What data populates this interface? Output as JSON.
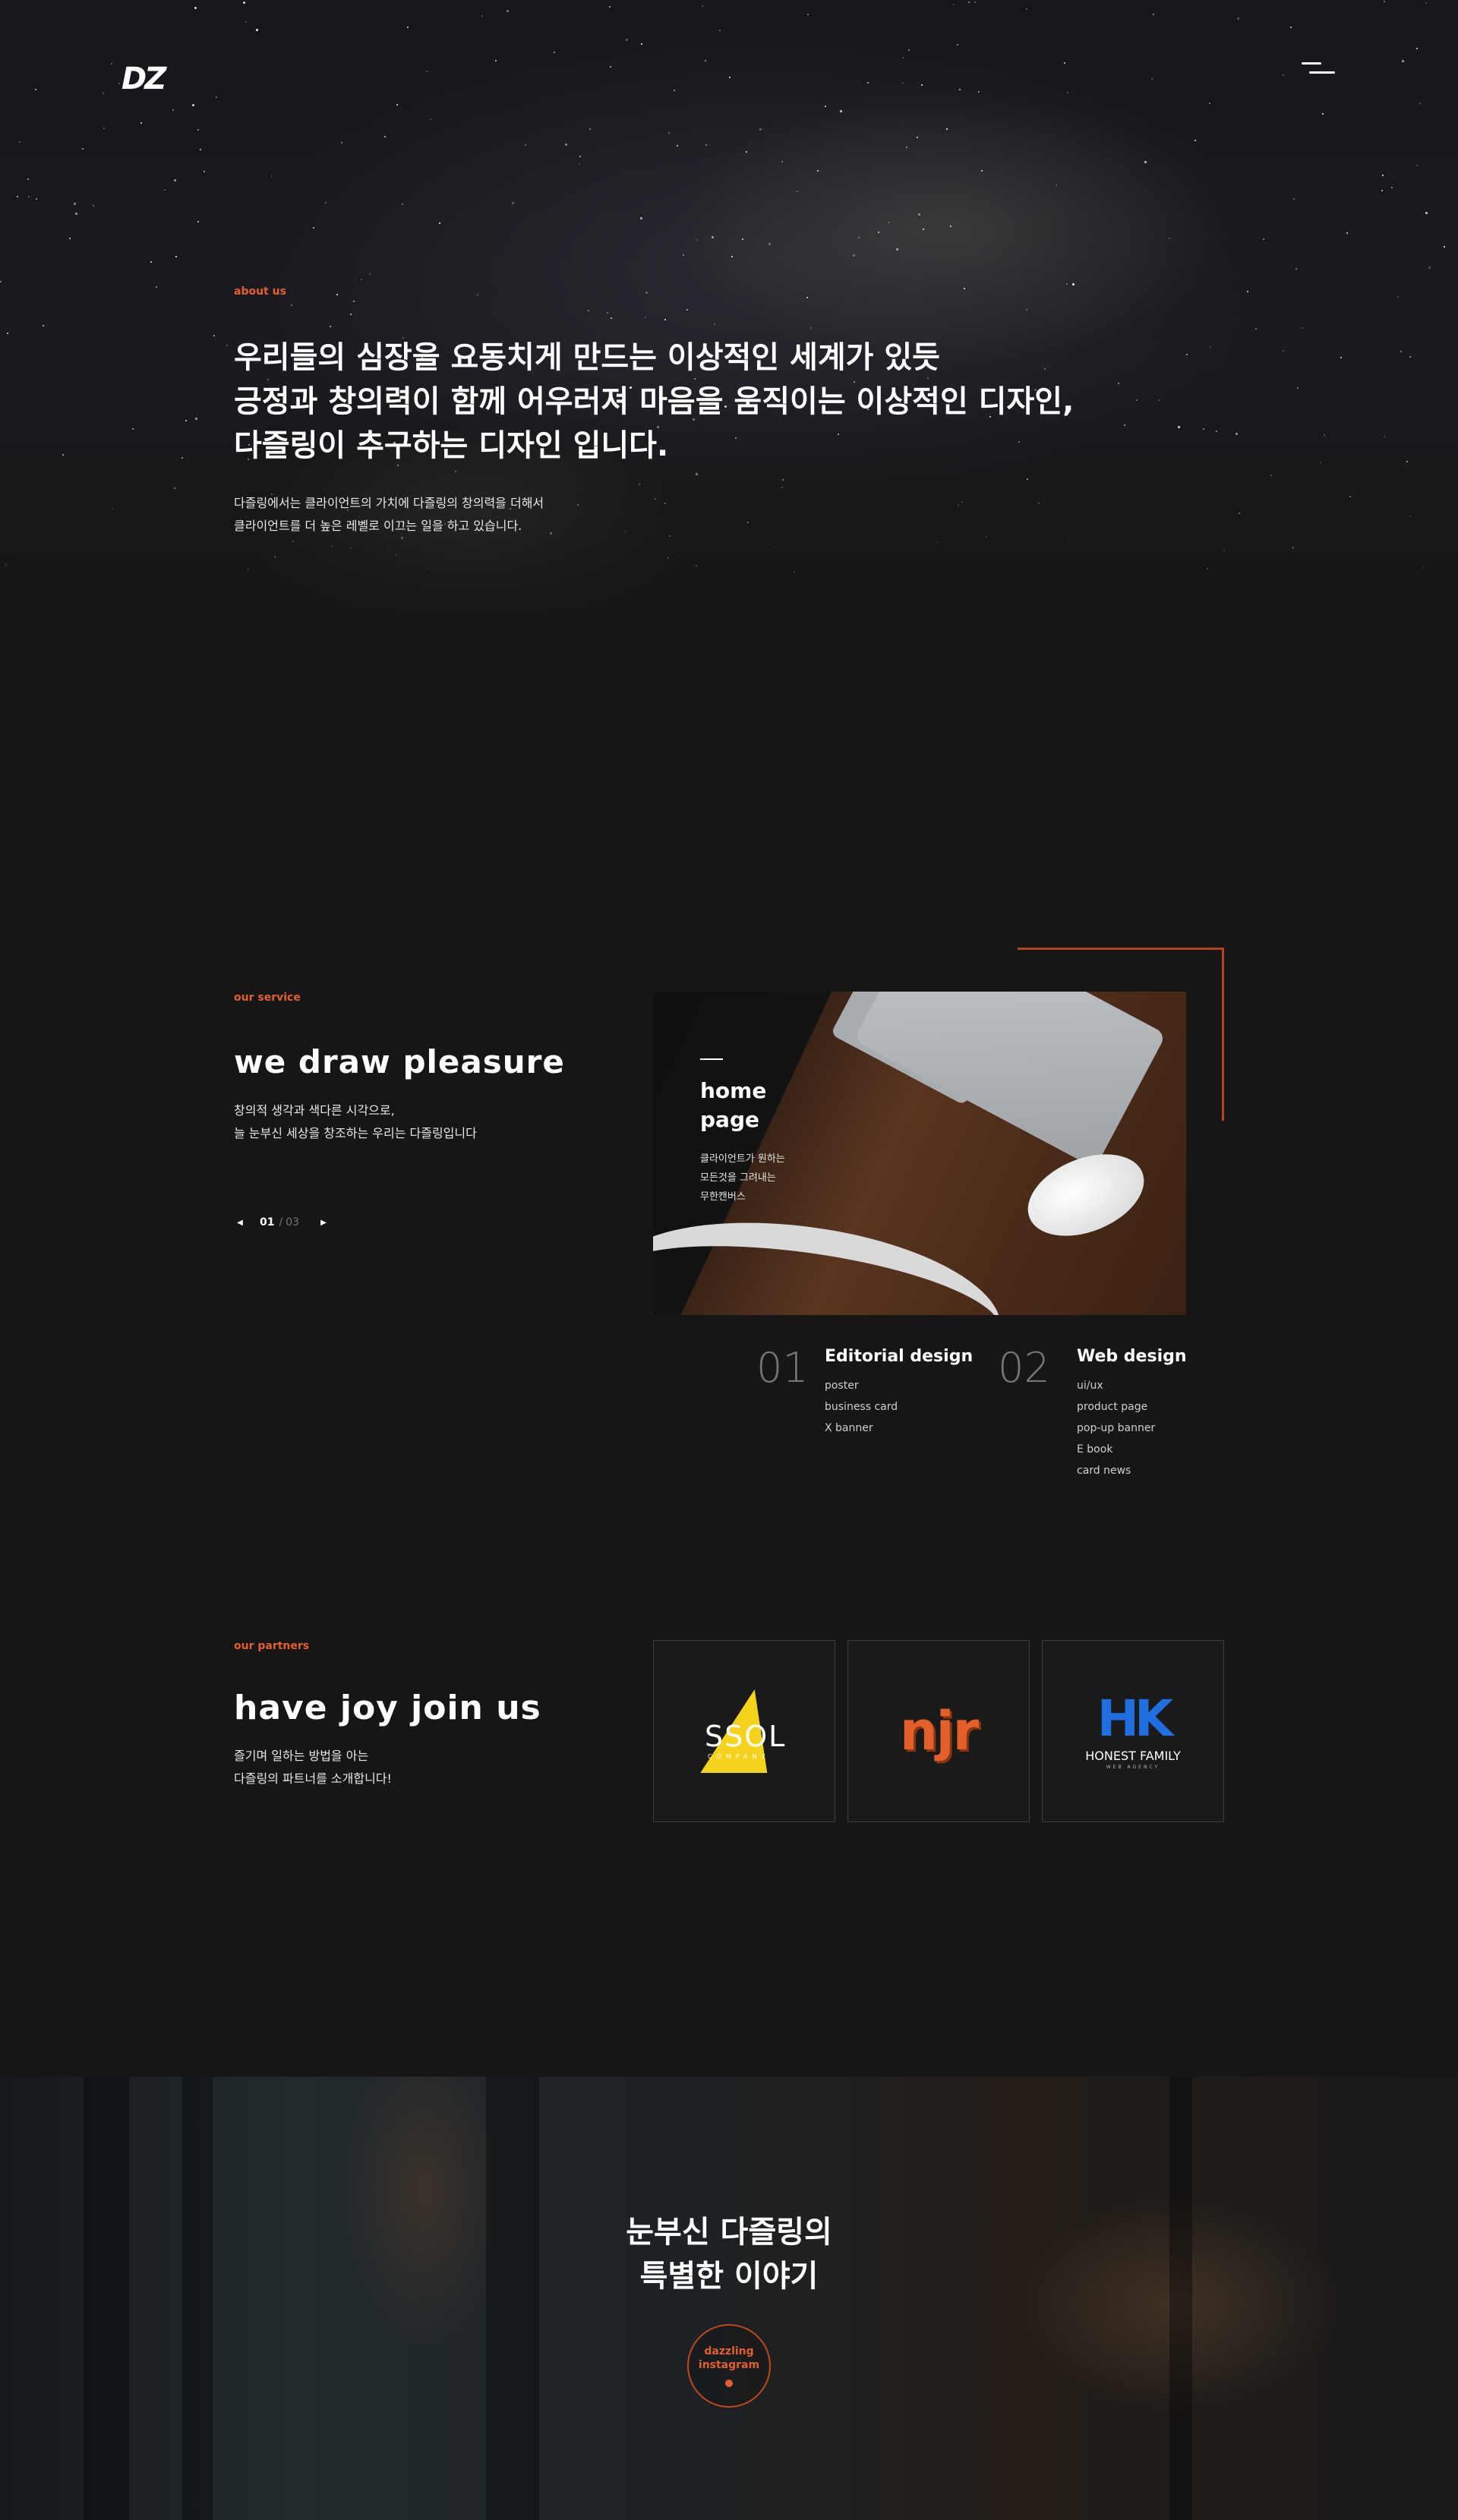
{
  "header": {
    "logo_text": "DZ",
    "menu_icon": "hamburger-icon"
  },
  "about": {
    "tag": "about us",
    "title_lines": [
      "우리들의 심장을 요동치게 만드는 이상적인 세계가 있듯",
      "긍정과 창의력이 함께 어우러져 마음을 움직이는 이상적인 디자인,",
      "다즐링이 추구하는 디자인 입니다."
    ],
    "desc_lines": [
      "다즐링에서는 클라이언트의 가치에 다즐링의 창의력을 더해서",
      "클라이언트를 더 높은 레벨로 이끄는 일을 하고 있습니다."
    ]
  },
  "service": {
    "tag": "our service",
    "title": "we draw pleasure",
    "desc_lines": [
      "창의적 생각과 색다른 시각으로,",
      "늘 눈부신 세상을 창조하는 우리는 다즐링입니다"
    ],
    "pager": {
      "current": "01",
      "separator": "/",
      "total": "03",
      "prev_icon": "triangle-left-icon",
      "next_icon": "triangle-right-icon"
    },
    "card": {
      "title_lines": [
        "home",
        "page"
      ],
      "desc_lines": [
        "클라이언트가 원하는",
        "모든것을 그려내는",
        "무한캔버스"
      ]
    },
    "items": [
      {
        "num": "01",
        "name": "Editorial design",
        "list": [
          "poster",
          "business card",
          "X banner"
        ]
      },
      {
        "num": "02",
        "name": "Web design",
        "list": [
          "ui/ux",
          "product page",
          "pop-up banner",
          "E book",
          "card news"
        ]
      }
    ]
  },
  "partners": {
    "tag": "our partners",
    "title": "have joy join us",
    "desc_lines": [
      "즐기며 일하는 방법을 아는",
      "다즐링의 파트너를 소개합니다!"
    ],
    "logos": [
      {
        "name": "SSOL",
        "sub": "COMPANY",
        "color": "#f5d21b"
      },
      {
        "name": "njr",
        "color": "#e3602a"
      },
      {
        "name": "HONEST FAMILY",
        "mark": "HK",
        "sub": "WEB AGENCY",
        "color": "#1f6fe0"
      }
    ]
  },
  "story": {
    "title_lines": [
      "눈부신 다즐링의",
      "특별한 이야기"
    ],
    "button_lines": [
      "dazzling",
      "instagram"
    ]
  },
  "colors": {
    "accent": "#e35f2d",
    "background": "#161616"
  }
}
